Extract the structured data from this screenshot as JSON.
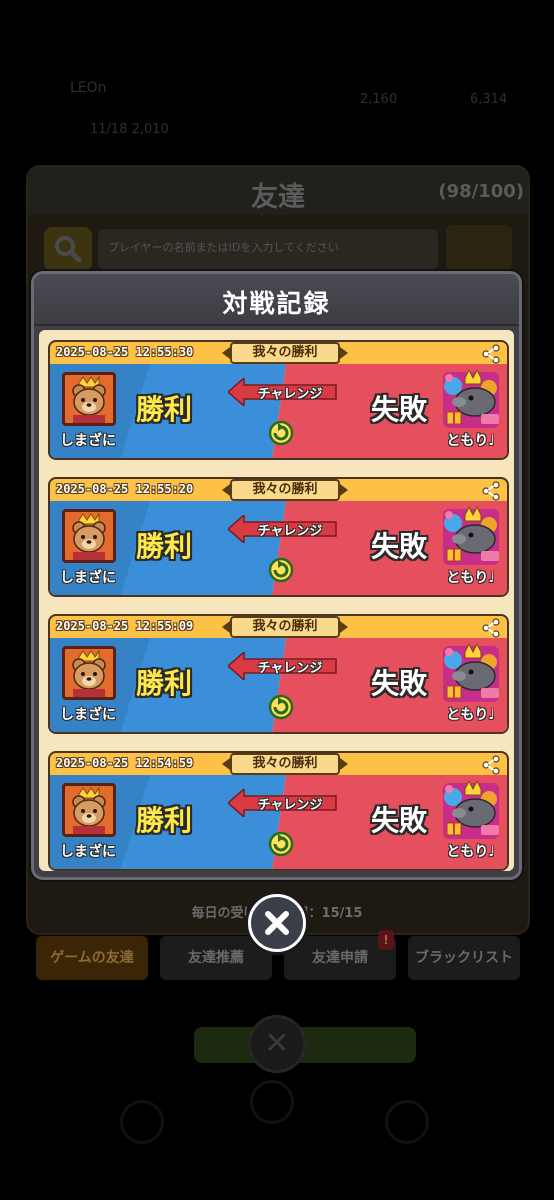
{
  "background": {
    "stats": {
      "a": "LEOn",
      "b": "2,160",
      "c": "6,314",
      "d": "11/18 2,010"
    },
    "title": "友達",
    "count": "(98/100)",
    "search_placeholder": "プレイヤーの名前またはIDを入力してください",
    "daily_limit": "毎日の受け取り上限：15/15",
    "tabs": [
      "ゲームの友達",
      "友達推薦",
      "友達申請",
      "ブラックリスト"
    ],
    "tab_badge": "!"
  },
  "modal": {
    "title": "対戦記録",
    "records": [
      {
        "time": "2025-08-25 12:55:30",
        "result": "我々の勝利",
        "left_name": "しまざに",
        "left_verdict": "勝利",
        "action": "チャレンジ",
        "right_verdict": "失敗",
        "right_name": "ともり♩"
      },
      {
        "time": "2025-08-25 12:55:20",
        "result": "我々の勝利",
        "left_name": "しまざに",
        "left_verdict": "勝利",
        "action": "チャレンジ",
        "right_verdict": "失敗",
        "right_name": "ともり♩"
      },
      {
        "time": "2025-08-25 12:55:09",
        "result": "我々の勝利",
        "left_name": "しまざに",
        "left_verdict": "勝利",
        "action": "チャレンジ",
        "right_verdict": "失敗",
        "right_name": "ともり♩"
      },
      {
        "time": "2025-08-25 12:54:59",
        "result": "我々の勝利",
        "left_name": "しまざに",
        "left_verdict": "勝利",
        "action": "チャレンジ",
        "right_verdict": "失敗",
        "right_name": "ともり♩"
      }
    ]
  },
  "icons": {
    "share": "share-icon",
    "replay": "replay-icon",
    "close": "close-icon",
    "search": "search-icon"
  },
  "colors": {
    "win_side": "#3a8fd9",
    "lose_side": "#e8505e",
    "header_gold": "#fdc245",
    "modal_bg": "#f7e6bd"
  }
}
